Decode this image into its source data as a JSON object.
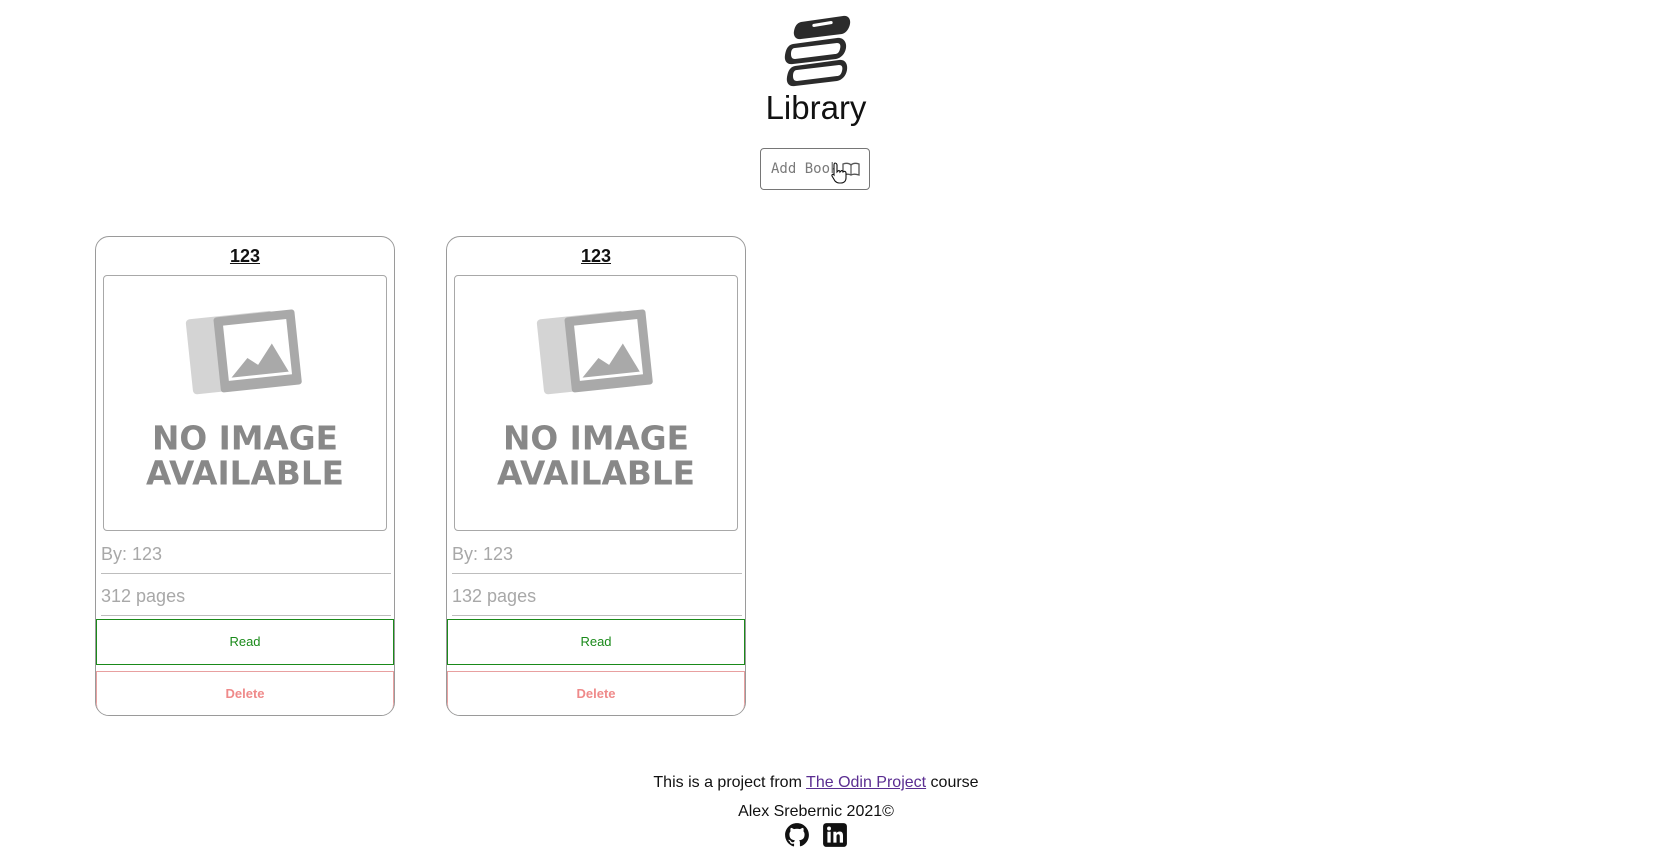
{
  "header": {
    "title": "Library",
    "add_button_label": "Add Book",
    "logo_icon": "books-stack-icon"
  },
  "books": [
    {
      "title": "123",
      "image_text_line1": "NO IMAGE",
      "image_text_line2": "AVAILABLE",
      "author": "By: 123",
      "pages": "312 pages",
      "read_label": "Read",
      "delete_label": "Delete"
    },
    {
      "title": "123",
      "image_text_line1": "NO IMAGE",
      "image_text_line2": "AVAILABLE",
      "author": "By: 123",
      "pages": "132 pages",
      "read_label": "Read",
      "delete_label": "Delete"
    }
  ],
  "footer": {
    "prefix": "This is a project from ",
    "link_text": "The Odin Project",
    "suffix": " course",
    "credit": "Alex Srebernic 2021©",
    "icons": [
      "github-icon",
      "linkedin-icon"
    ]
  },
  "colors": {
    "read": "#1a8a1a",
    "delete": "#ef8a8a",
    "link": "#5a2d91"
  }
}
